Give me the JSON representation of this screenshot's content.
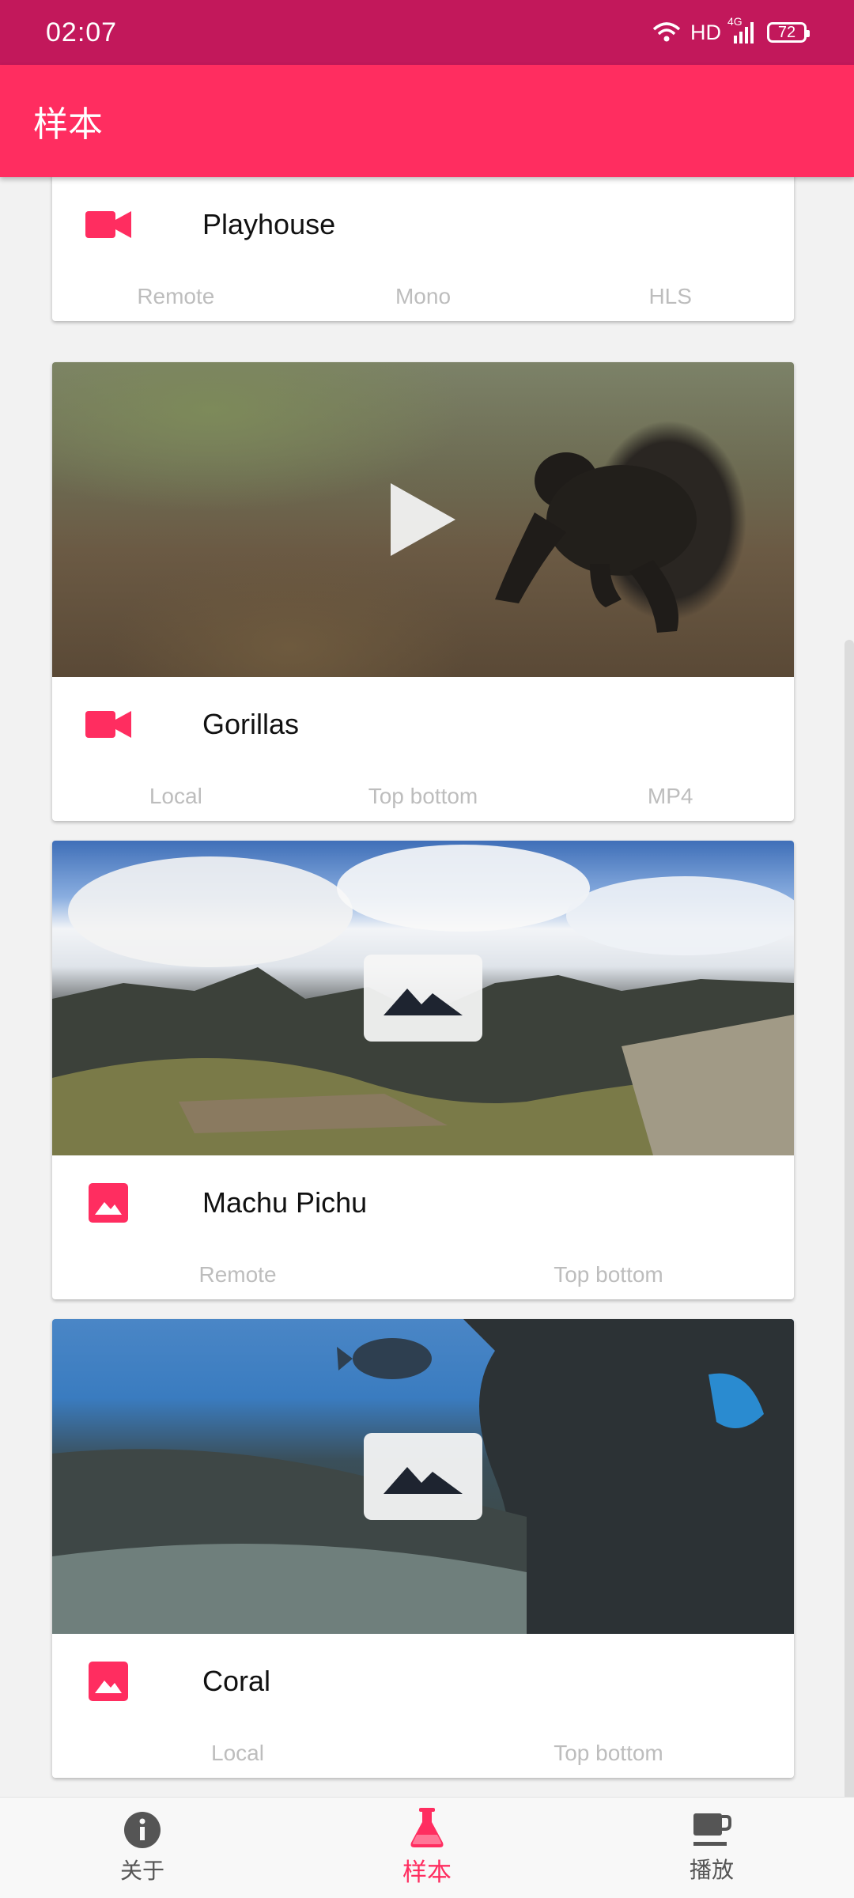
{
  "status_bar": {
    "time": "02:07",
    "network_label": "HD",
    "signal_label": "4G",
    "battery": "72"
  },
  "app_bar": {
    "title": "样本"
  },
  "colors": {
    "accent": "#ff2d60",
    "status": "#c2185b"
  },
  "cards": [
    {
      "title": "Playhouse",
      "media_type": "video",
      "icon": "videocam-icon",
      "tags": [
        "Remote",
        "Mono",
        "HLS"
      ]
    },
    {
      "title": "Gorillas",
      "media_type": "video",
      "icon": "videocam-icon",
      "tags": [
        "Local",
        "Top bottom",
        "MP4"
      ]
    },
    {
      "title": "Machu Pichu",
      "media_type": "image",
      "icon": "image-icon",
      "tags": [
        "Remote",
        "Top bottom"
      ]
    },
    {
      "title": "Coral",
      "media_type": "image",
      "icon": "image-icon",
      "tags": [
        "Local",
        "Top bottom"
      ]
    }
  ],
  "bottom_nav": [
    {
      "label": "关于",
      "icon": "info-icon",
      "active": false
    },
    {
      "label": "样本",
      "icon": "flask-icon",
      "active": true
    },
    {
      "label": "播放",
      "icon": "coffee-icon",
      "active": false
    }
  ]
}
